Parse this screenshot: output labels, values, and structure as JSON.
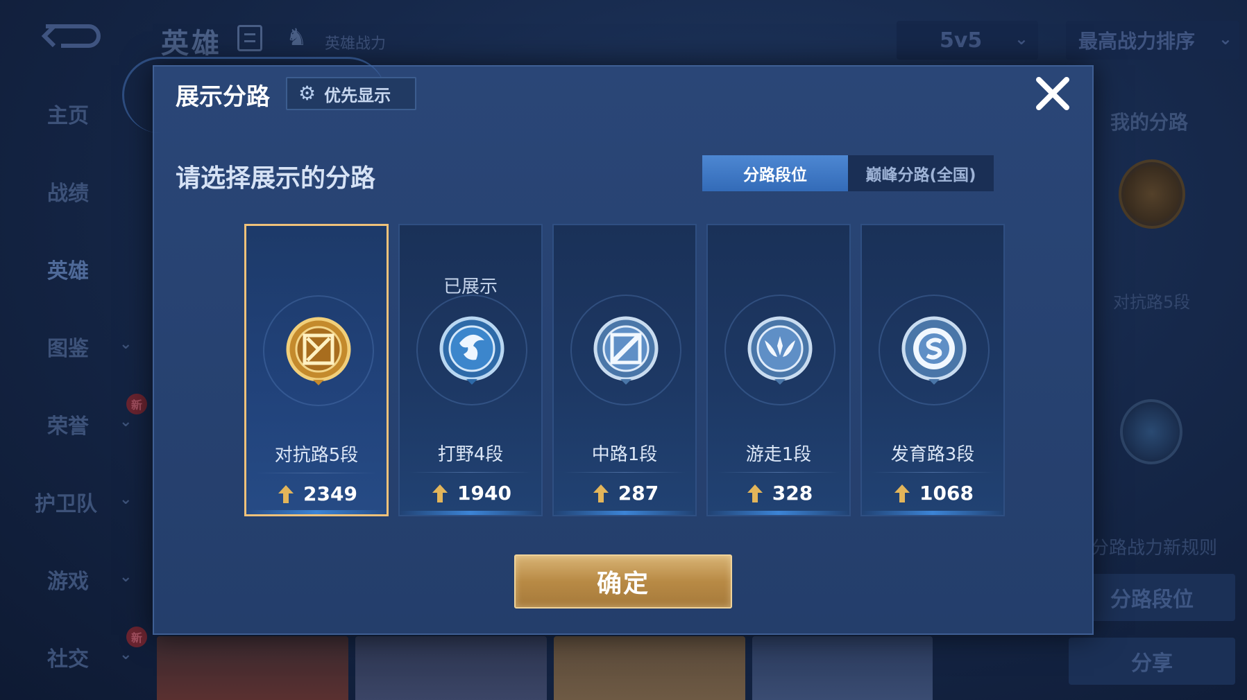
{
  "app": {
    "page_title": "英雄",
    "hero_power_label": "英雄战力",
    "mode_select": "5v5",
    "sort_select": "最高战力排序"
  },
  "sidebar": {
    "items": [
      {
        "label": "主页",
        "has_chevron": false
      },
      {
        "label": "战绩",
        "has_chevron": false
      },
      {
        "label": "英雄",
        "has_chevron": false,
        "active": true
      },
      {
        "label": "图鉴",
        "has_chevron": true
      },
      {
        "label": "荣誉",
        "has_chevron": true,
        "badge": "新"
      },
      {
        "label": "护卫队",
        "has_chevron": true
      },
      {
        "label": "游戏",
        "has_chevron": true
      },
      {
        "label": "社交",
        "has_chevron": true,
        "badge": "新"
      }
    ]
  },
  "right_panel": {
    "title": "我的分路",
    "rank_label": "对抗路5段",
    "rule_text": "分路战力新规则",
    "rank_button": "分路段位",
    "share_button": "分享"
  },
  "modal": {
    "title": "展示分路",
    "priority_button": "优先显示",
    "section_title": "请选择展示的分路",
    "tabs": [
      {
        "label": "分路段位",
        "active": true
      },
      {
        "label": "巅峰分路(全国)",
        "active": false
      }
    ],
    "cards": [
      {
        "rank": "对抗路5段",
        "score": "2349",
        "shown_label": "",
        "selected": true,
        "emblem": "clash-lane-icon",
        "color": "#d9a547"
      },
      {
        "rank": "打野4段",
        "score": "1940",
        "shown_label": "已展示",
        "selected": false,
        "emblem": "jungle-dragon-icon",
        "color": "#5aa8e8"
      },
      {
        "rank": "中路1段",
        "score": "287",
        "shown_label": "",
        "selected": false,
        "emblem": "mid-lane-icon",
        "color": "#8fb6e0"
      },
      {
        "rank": "游走1段",
        "score": "328",
        "shown_label": "",
        "selected": false,
        "emblem": "roam-wings-icon",
        "color": "#8fb6e0"
      },
      {
        "rank": "发育路3段",
        "score": "1068",
        "shown_label": "",
        "selected": false,
        "emblem": "farm-lane-icon",
        "color": "#8fb6e0"
      }
    ],
    "confirm_button": "确定"
  },
  "colors": {
    "accent_gold": "#f0c27a",
    "tab_active": "#3f79c6",
    "modal_bg": "#2a4677"
  }
}
